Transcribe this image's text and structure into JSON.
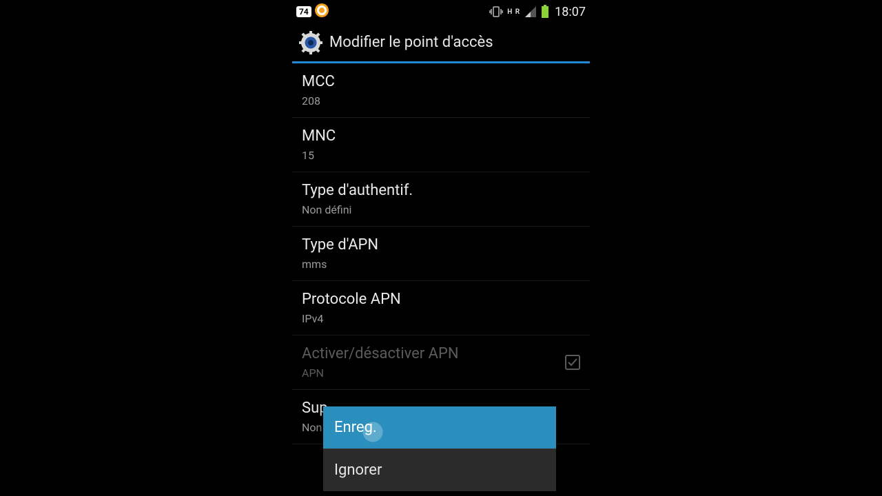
{
  "statusbar": {
    "battery_pct": "74",
    "network_letters": "H R",
    "clock": "18:07"
  },
  "actionbar": {
    "title": "Modifier le point d'accès"
  },
  "rows": [
    {
      "title": "MCC",
      "value": "208"
    },
    {
      "title": "MNC",
      "value": "15"
    },
    {
      "title": "Type d'authentif.",
      "value": "Non défini"
    },
    {
      "title": "Type d'APN",
      "value": "mms"
    },
    {
      "title": "Protocole APN",
      "value": "IPv4"
    },
    {
      "title": "Activer/désactiver APN",
      "value": "APN"
    },
    {
      "title": "Sup",
      "value": "Non"
    }
  ],
  "menu": {
    "save": "Enreg.",
    "discard": "Ignorer"
  }
}
